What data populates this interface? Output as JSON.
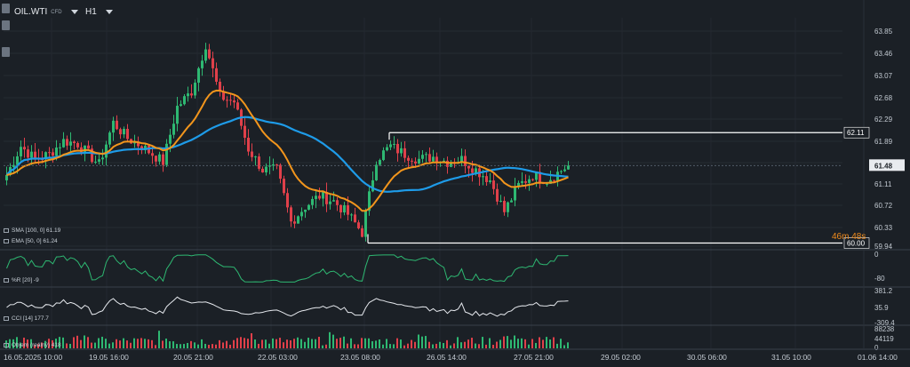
{
  "header": {
    "symbol": "OIL.WTI",
    "symbol_tag": "CFD",
    "timeframe": "H1"
  },
  "price_axis": {
    "labels": [
      "63.85",
      "63.46",
      "63.07",
      "62.68",
      "62.29",
      "61.89",
      "61.50",
      "61.11",
      "60.72",
      "60.33",
      "59.94"
    ]
  },
  "markers": {
    "high_line": "62.11",
    "current_price": "61.48",
    "low_line": "60.00",
    "countdown": "46m 48s"
  },
  "legends": {
    "sma": "SMA [100, 0]  61.19",
    "ema": "EMA [50, 0]  61.24",
    "wr": "%R [20]  -9",
    "cci": "CCI [14]  177.7",
    "volume": "Objem (reálný)  418"
  },
  "wr_axis": {
    "top": "0",
    "bottom": "-80"
  },
  "cci_axis": {
    "top": "381.2",
    "mid": "35.9",
    "bottom": "-309.4"
  },
  "vol_axis": {
    "top": "88238",
    "mid": "44119",
    "bottom": "0"
  },
  "time_axis": [
    {
      "label": "16.05.2025  10:00"
    },
    {
      "label": "19.05  16:00"
    },
    {
      "label": "20.05  21:00"
    },
    {
      "label": "22.05  03:00"
    },
    {
      "label": "23.05  08:00"
    },
    {
      "label": "26.05  14:00"
    },
    {
      "label": "27.05  21:00"
    },
    {
      "label": "29.05  02:00"
    },
    {
      "label": "30.05  06:00"
    },
    {
      "label": "31.05  10:00"
    },
    {
      "label": "01.06  14:00"
    }
  ],
  "colors": {
    "background": "#1b2026",
    "bull": "#2eb872",
    "bear": "#e0404a",
    "sma": "#1e9be8",
    "ema": "#f2951c",
    "line": "#ffffff"
  },
  "chart_data": {
    "type": "candlestick",
    "ylim": [
      59.94,
      64.05
    ],
    "sma_last": 61.19,
    "ema_last": 61.24,
    "last_price": 61.48,
    "high_marker": 62.11,
    "low_marker": 60.0,
    "close_path": [
      [
        0,
        61.3
      ],
      [
        4,
        61.85
      ],
      [
        8,
        61.6
      ],
      [
        12,
        61.7
      ],
      [
        16,
        61.95
      ],
      [
        20,
        61.9
      ],
      [
        26,
        61.5
      ],
      [
        30,
        62.3
      ],
      [
        34,
        62.0
      ],
      [
        38,
        61.85
      ],
      [
        44,
        61.55
      ],
      [
        48,
        62.6
      ],
      [
        52,
        62.9
      ],
      [
        56,
        63.8
      ],
      [
        60,
        62.8
      ],
      [
        64,
        62.7
      ],
      [
        68,
        61.8
      ],
      [
        72,
        61.4
      ],
      [
        76,
        61.4
      ],
      [
        80,
        60.4
      ],
      [
        84,
        60.7
      ],
      [
        88,
        60.9
      ],
      [
        92,
        60.8
      ],
      [
        96,
        60.55
      ],
      [
        100,
        60.2
      ],
      [
        104,
        61.6
      ],
      [
        108,
        61.85
      ],
      [
        112,
        61.7
      ],
      [
        116,
        61.6
      ],
      [
        120,
        61.65
      ],
      [
        124,
        61.55
      ],
      [
        128,
        61.6
      ],
      [
        132,
        61.4
      ],
      [
        136,
        61.2
      ],
      [
        140,
        60.6
      ],
      [
        144,
        61.1
      ],
      [
        148,
        61.3
      ],
      [
        152,
        61.2
      ],
      [
        158,
        61.48
      ]
    ]
  }
}
